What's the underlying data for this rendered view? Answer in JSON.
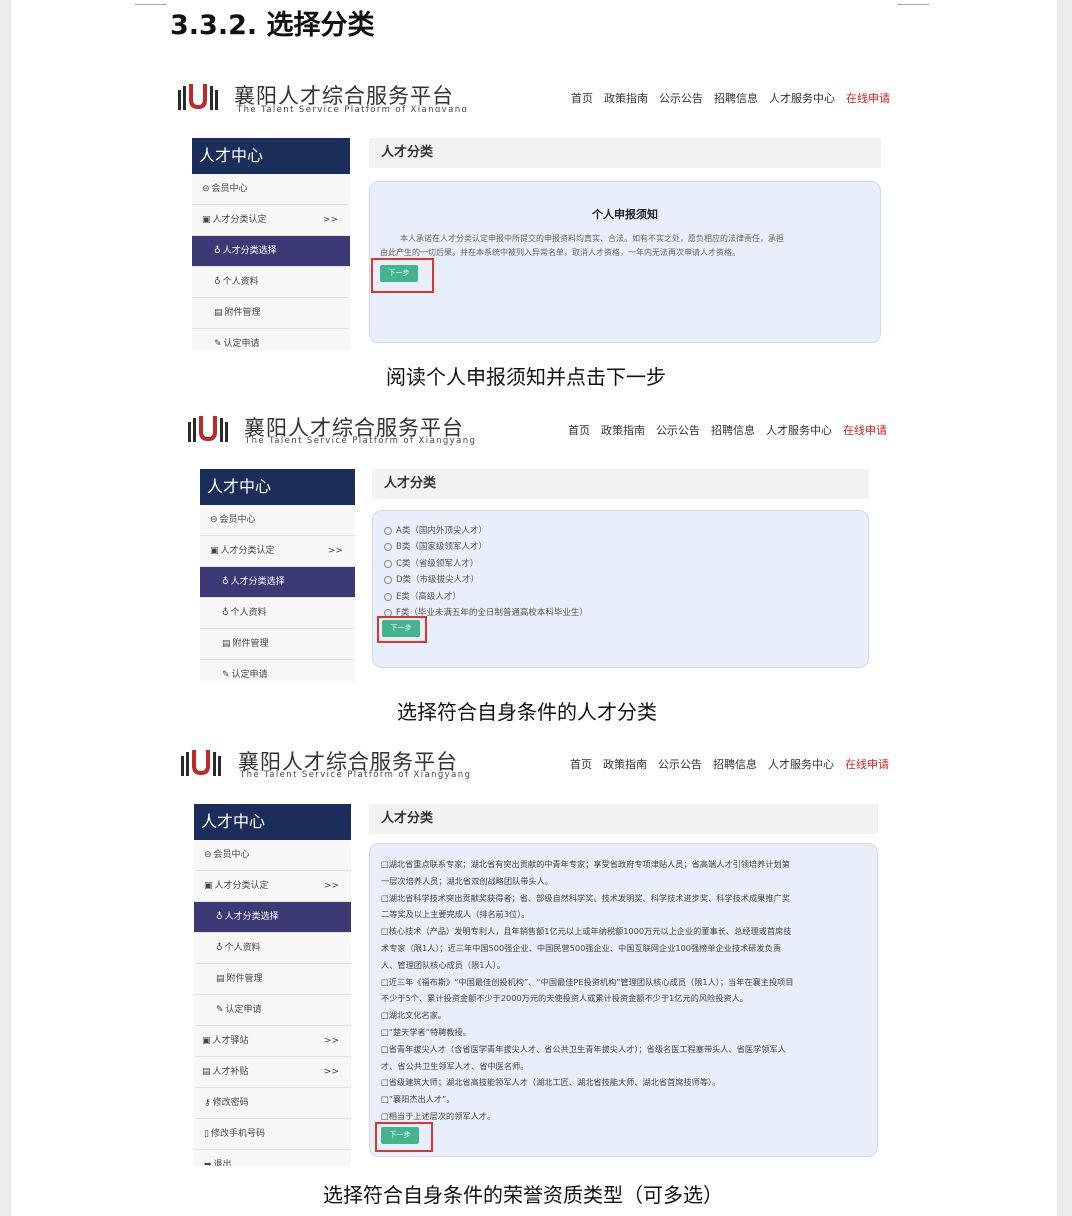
{
  "heading": "3.3.2. 选择分类",
  "brand": {
    "cn": "襄阳人才综合服务平台",
    "en": "The Talent Service Platform of Xiangyang"
  },
  "nav": {
    "home": "首页",
    "policy": "政策指南",
    "notice": "公示公告",
    "recruit": "招聘信息",
    "service": "人才服务中心",
    "apply": "在线申请"
  },
  "sidebar": {
    "title": "人才中心",
    "items": [
      "会员中心",
      "人才分类认定",
      "人才分类选择",
      "个人资料",
      "附件管理",
      "认定申请"
    ],
    "extra": [
      "人才驿站",
      "人才补贴",
      "修改密码",
      "修改手机号码",
      "退出"
    ],
    "arrow": ">>"
  },
  "main_title": "人才分类",
  "notice": {
    "title": "个人申报须知",
    "line1": "本人承诺在人才分类认定申报中所提交的申报资料均真实、合法。如有不实之处，愿负相应的法律责任，承担",
    "line2": "由此产生的一切后果。并在本系统中被列入异常名单，取消人才资格，一年内无法再次申请人才资格。"
  },
  "next_label": "下一步",
  "categories": [
    "A类（国内外顶尖人才）",
    "B类（国家级领军人才）",
    "C类（省级领军人才）",
    "D类（市级拔尖人才）",
    "E类（高级人才）",
    "F类（毕业未满五年的全日制普通高校本科毕业生）"
  ],
  "honors": [
    "□湖北省重点联系专家；湖北省有突出贡献的中青年专家；享受省政府专项津贴人员；省高端人才引领培养计划第",
    "一层次培养人员；湖北省双创战略团队带头人。",
    "□湖北省科学技术突出贡献奖获得者；省、部级自然科学奖、技术发明奖、科学技术进步奖、科学技术成果推广奖",
    "二等奖及以上主要完成人（排名前3位）。",
    "□核心技术（产品）发明专利人，且年销售额1亿元以上或年纳税额1000万元以上企业的董事长、总经理或首席技",
    "术专家（限1人）；近三年中国500强企业、中国民营500强企业、中国互联网企业100强榜单企业技术研发负责",
    "人、管理团队核心成员（限1人）。",
    "□近三年《福布斯》“中国最佳创投机构”、“中国最佳PE投资机构”管理团队核心成员（限1人）；当年在襄主投项目",
    "不少于5个、累计投资金额不少于2000万元的天使投资人或累计投资金额不少于1亿元的风险投资人。",
    "□湖北文化名家。",
    "□“楚天学者”特聘教授。",
    "□省青年拔尖人才（含省医学青年拔尖人才、省公共卫生青年拔尖人才）；省级名医工程塞带头人、省医学领军人",
    "才、省公共卫生领军人才、省中医名师。",
    "□省级建筑大师；湖北省高技能领军人才（湖北工匠、湖北省技能大师、湖北省首席技师等）。",
    "□“襄阳杰出人才”。",
    "□相当于上述层次的领军人才。"
  ],
  "captions": [
    "阅读个人申报须知并点击下一步",
    "选择符合自身条件的人才分类",
    "选择符合自身条件的荣誉资质类型（可多选）"
  ],
  "colors": {
    "sidebar_header": "#1b2d5b",
    "sidebar_active": "#3b3a75",
    "button": "#43b48e",
    "highlight_box": "#d9372e",
    "nav_hot": "#e02020"
  }
}
